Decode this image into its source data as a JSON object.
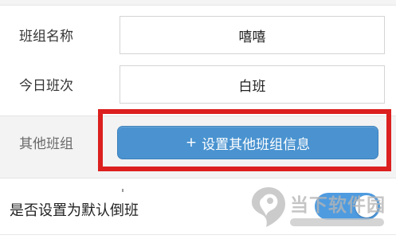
{
  "form": {
    "group_name": {
      "label": "班组名称",
      "value": "嘻嘻"
    },
    "today_shift": {
      "label": "今日班次",
      "value": "白班"
    },
    "other_groups": {
      "label": "其他班组",
      "button_plus": "+",
      "button_label": "设置其他班组信息"
    },
    "default_rotation": {
      "label": "是否设置为默认倒班",
      "toggle_on": true
    }
  },
  "colors": {
    "accent": "#4a93d0",
    "highlight": "#dc1f1f",
    "toggle": "#4e9be0"
  },
  "watermark": {
    "text": "当下软件园",
    "icon": "watermark-logo-icon"
  }
}
